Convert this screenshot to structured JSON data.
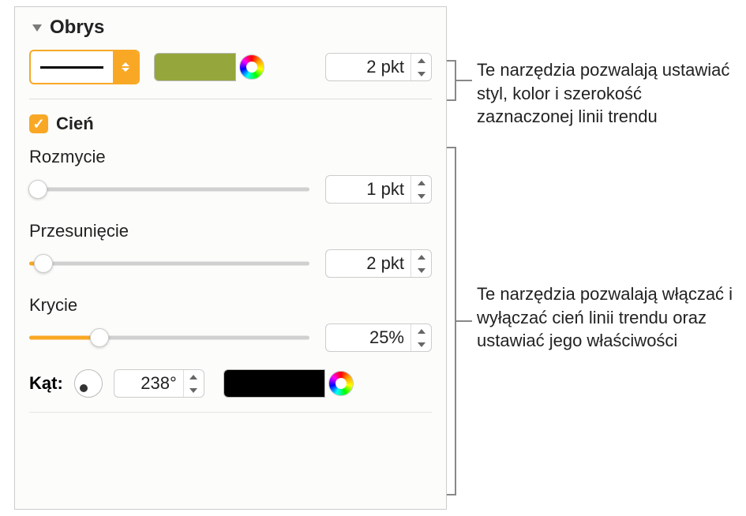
{
  "stroke": {
    "title": "Obrys",
    "width_value": "2 pkt",
    "color": "#94a63c"
  },
  "shadow": {
    "label": "Cień",
    "checked": true,
    "blur": {
      "label": "Rozmycie",
      "value": "1 pkt",
      "percent": 1
    },
    "offset": {
      "label": "Przesunięcie",
      "value": "2 pkt",
      "percent": 3
    },
    "opacity": {
      "label": "Krycie",
      "value": "25%",
      "percent": 25
    },
    "angle": {
      "label": "Kąt:",
      "value": "238°"
    },
    "shadow_color": "#000000"
  },
  "callouts": {
    "stroke": "Te narzędzia pozwalają ustawiać styl, kolor i szerokość zaznaczonej linii trendu",
    "shadow": "Te narzędzia pozwalają włączać i wyłączać cień linii trendu oraz ustawiać jego właściwości"
  }
}
